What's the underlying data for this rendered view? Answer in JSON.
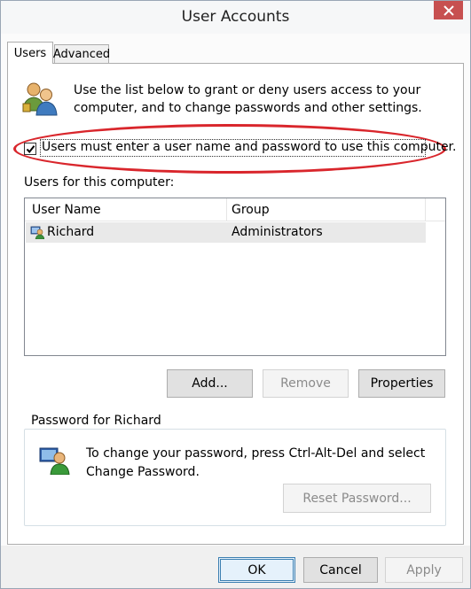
{
  "window": {
    "title": "User Accounts"
  },
  "tabs": [
    {
      "label": "Users",
      "selected": true
    },
    {
      "label": "Advanced",
      "selected": false
    }
  ],
  "intro_text": "Use the list below to grant or deny users access to your computer, and to change passwords and other settings.",
  "require_login": {
    "label": "Users must enter a user name and password to use this computer.",
    "checked": true
  },
  "users_list": {
    "label": "Users for this computer:",
    "columns": [
      "User Name",
      "Group"
    ],
    "rows": [
      {
        "user": "Richard",
        "group": "Administrators"
      }
    ]
  },
  "list_buttons": {
    "add": "Add...",
    "remove": "Remove",
    "properties": "Properties"
  },
  "password_group": {
    "title": "Password for Richard",
    "text": "To change your password, press Ctrl-Alt-Del and select Change Password.",
    "reset_button": "Reset Password..."
  },
  "dialog_buttons": {
    "ok": "OK",
    "cancel": "Cancel",
    "apply": "Apply"
  },
  "colors": {
    "close_button": "#c75050",
    "highlight_ellipse": "#d9262c",
    "disabled_text": "#8b8b8b"
  },
  "icons": {
    "users": "users-icon",
    "user_row": "user-icon",
    "password": "user-password-icon",
    "close": "close-icon",
    "checkmark": "checkmark-icon"
  }
}
